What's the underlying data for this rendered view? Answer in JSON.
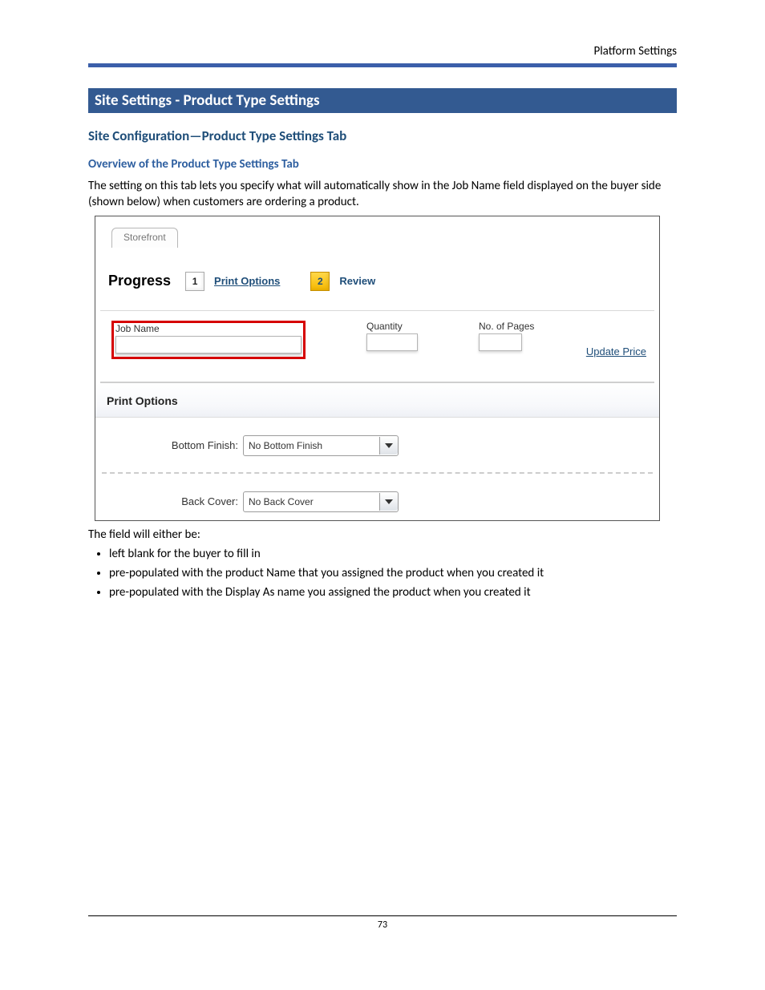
{
  "header": {
    "running": "Platform Settings"
  },
  "section_banner": "Site Settings - Product Type Settings",
  "h2": "Site Configuration—Product Type Settings Tab",
  "h3": "Overview of the Product Type Settings Tab",
  "intro": "The setting on this tab lets you specify what will automatically show in the Job Name field displayed on the buyer side (shown below) when customers are ordering a product.",
  "screenshot": {
    "tab": "Storefront",
    "progress_label": "Progress",
    "steps": [
      {
        "num": "1",
        "label": "Print Options"
      },
      {
        "num": "2",
        "label": "Review"
      }
    ],
    "fields": {
      "job_name_label": "Job Name",
      "quantity_label": "Quantity",
      "pages_label": "No. of Pages",
      "update_price": "Update Price"
    },
    "subheader": "Print Options",
    "options": [
      {
        "label": "Bottom Finish:",
        "value": "No Bottom Finish"
      },
      {
        "label": "Back Cover:",
        "value": "No Back Cover"
      }
    ]
  },
  "post_text": "The field will either be:",
  "bullets": [
    "left blank for the buyer to fill in",
    "pre-populated with the product Name that you assigned the product when you created it",
    "pre-populated with the Display As name you assigned the product when you created it"
  ],
  "page_number": "73"
}
